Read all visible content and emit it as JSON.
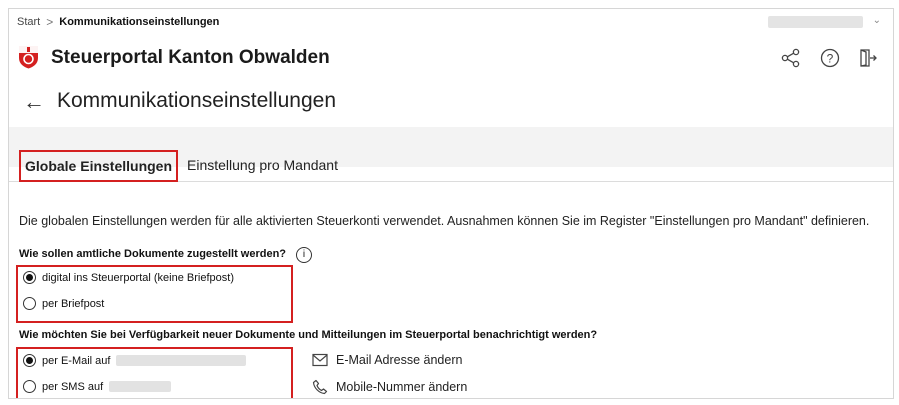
{
  "breadcrumb": {
    "start": "Start",
    "separator": ">",
    "current": "Kommunikationseinstellungen"
  },
  "header": {
    "app_title": "Steuerportal Kanton Obwalden",
    "icons": [
      "share-icon",
      "help-icon",
      "logout-icon"
    ]
  },
  "page": {
    "title": "Kommunikationseinstellungen",
    "back_icon": "arrow-left-icon"
  },
  "tabs": [
    {
      "label": "Globale Einstellungen",
      "active": true
    },
    {
      "label": "Einstellung pro Mandant",
      "active": false
    }
  ],
  "description": "Die globalen Einstellungen werden für alle aktivierten Steuerkonti verwendet. Ausnahmen können Sie im Register \"Einstellungen pro Mandant\" definieren.",
  "delivery": {
    "question": "Wie sollen amtliche Dokumente zugestellt werden?",
    "info_icon": "i",
    "options": [
      {
        "label": "digital ins Steuerportal (keine Briefpost)",
        "selected": true
      },
      {
        "label": "per Briefpost",
        "selected": false
      }
    ]
  },
  "notify": {
    "question": "Wie möchten Sie bei Verfügbarkeit neuer Dokumente und Mitteilungen im Steuerportal benachrichtigt werden?",
    "options": [
      {
        "label": "per E-Mail auf",
        "selected": true
      },
      {
        "label": "per SMS auf",
        "selected": false
      }
    ],
    "email_link": "E-Mail Adresse ändern",
    "mobile_link": "Mobile-Nummer ändern"
  },
  "colors": {
    "accent_red": "#d42020",
    "band_gray": "#f3f3f3"
  }
}
